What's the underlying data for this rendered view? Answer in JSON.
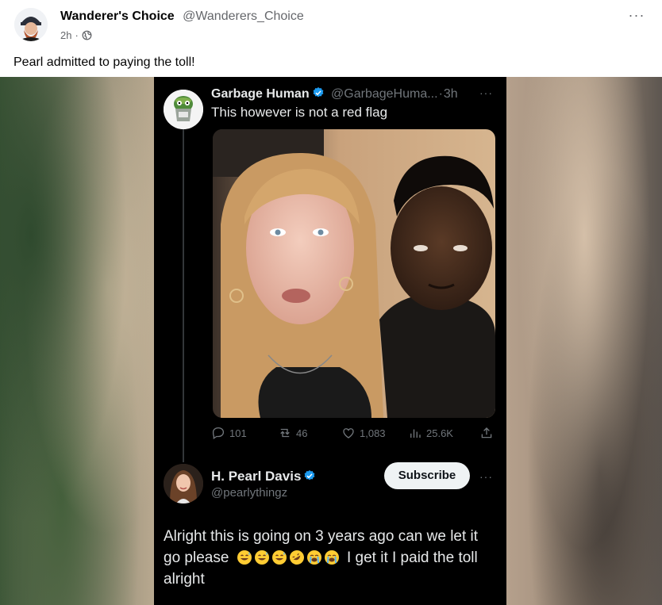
{
  "post": {
    "author_name": "Wanderer's Choice",
    "author_handle": "@Wanderers_Choice",
    "time": "2h",
    "time_separator": "·",
    "more_label": "···",
    "text": "Pearl admitted to paying the toll!"
  },
  "tweet1": {
    "name": "Garbage Human",
    "handle": "@GarbageHuma...",
    "separator": "·",
    "time": "3h",
    "more_label": "···",
    "text": "This however is not a red flag",
    "actions": {
      "replies": "101",
      "retweets": "46",
      "likes": "1,083",
      "views": "25.6K"
    }
  },
  "tweet2": {
    "name": "H. Pearl Davis",
    "handle": "@pearlythingz",
    "subscribe_label": "Subscribe",
    "more_label": "···",
    "text_part1": "Alright this is going on 3 years ago can we let it go please",
    "text_part2": "I get it I paid the toll alright",
    "emojis": [
      "sweat-smile-emoji",
      "sweat-smile-emoji",
      "sweat-smile-emoji",
      "rofl-emoji",
      "sob-emoji",
      "sob-emoji"
    ]
  },
  "colors": {
    "verified": "#1d9bf0",
    "tweet_bg": "#000000",
    "secondary_text": "#71767b",
    "subscribe_bg": "#eff3f4"
  }
}
